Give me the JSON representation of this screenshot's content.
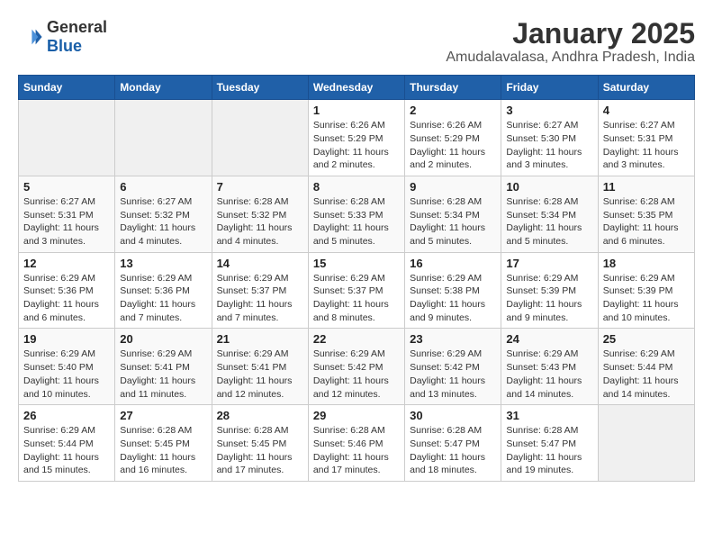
{
  "header": {
    "logo_general": "General",
    "logo_blue": "Blue",
    "month_title": "January 2025",
    "location": "Amudalavalasa, Andhra Pradesh, India"
  },
  "days_of_week": [
    "Sunday",
    "Monday",
    "Tuesday",
    "Wednesday",
    "Thursday",
    "Friday",
    "Saturday"
  ],
  "weeks": [
    [
      {
        "day": "",
        "info": ""
      },
      {
        "day": "",
        "info": ""
      },
      {
        "day": "",
        "info": ""
      },
      {
        "day": "1",
        "info": "Sunrise: 6:26 AM\nSunset: 5:29 PM\nDaylight: 11 hours\nand 2 minutes."
      },
      {
        "day": "2",
        "info": "Sunrise: 6:26 AM\nSunset: 5:29 PM\nDaylight: 11 hours\nand 2 minutes."
      },
      {
        "day": "3",
        "info": "Sunrise: 6:27 AM\nSunset: 5:30 PM\nDaylight: 11 hours\nand 3 minutes."
      },
      {
        "day": "4",
        "info": "Sunrise: 6:27 AM\nSunset: 5:31 PM\nDaylight: 11 hours\nand 3 minutes."
      }
    ],
    [
      {
        "day": "5",
        "info": "Sunrise: 6:27 AM\nSunset: 5:31 PM\nDaylight: 11 hours\nand 3 minutes."
      },
      {
        "day": "6",
        "info": "Sunrise: 6:27 AM\nSunset: 5:32 PM\nDaylight: 11 hours\nand 4 minutes."
      },
      {
        "day": "7",
        "info": "Sunrise: 6:28 AM\nSunset: 5:32 PM\nDaylight: 11 hours\nand 4 minutes."
      },
      {
        "day": "8",
        "info": "Sunrise: 6:28 AM\nSunset: 5:33 PM\nDaylight: 11 hours\nand 5 minutes."
      },
      {
        "day": "9",
        "info": "Sunrise: 6:28 AM\nSunset: 5:34 PM\nDaylight: 11 hours\nand 5 minutes."
      },
      {
        "day": "10",
        "info": "Sunrise: 6:28 AM\nSunset: 5:34 PM\nDaylight: 11 hours\nand 5 minutes."
      },
      {
        "day": "11",
        "info": "Sunrise: 6:28 AM\nSunset: 5:35 PM\nDaylight: 11 hours\nand 6 minutes."
      }
    ],
    [
      {
        "day": "12",
        "info": "Sunrise: 6:29 AM\nSunset: 5:36 PM\nDaylight: 11 hours\nand 6 minutes."
      },
      {
        "day": "13",
        "info": "Sunrise: 6:29 AM\nSunset: 5:36 PM\nDaylight: 11 hours\nand 7 minutes."
      },
      {
        "day": "14",
        "info": "Sunrise: 6:29 AM\nSunset: 5:37 PM\nDaylight: 11 hours\nand 7 minutes."
      },
      {
        "day": "15",
        "info": "Sunrise: 6:29 AM\nSunset: 5:37 PM\nDaylight: 11 hours\nand 8 minutes."
      },
      {
        "day": "16",
        "info": "Sunrise: 6:29 AM\nSunset: 5:38 PM\nDaylight: 11 hours\nand 9 minutes."
      },
      {
        "day": "17",
        "info": "Sunrise: 6:29 AM\nSunset: 5:39 PM\nDaylight: 11 hours\nand 9 minutes."
      },
      {
        "day": "18",
        "info": "Sunrise: 6:29 AM\nSunset: 5:39 PM\nDaylight: 11 hours\nand 10 minutes."
      }
    ],
    [
      {
        "day": "19",
        "info": "Sunrise: 6:29 AM\nSunset: 5:40 PM\nDaylight: 11 hours\nand 10 minutes."
      },
      {
        "day": "20",
        "info": "Sunrise: 6:29 AM\nSunset: 5:41 PM\nDaylight: 11 hours\nand 11 minutes."
      },
      {
        "day": "21",
        "info": "Sunrise: 6:29 AM\nSunset: 5:41 PM\nDaylight: 11 hours\nand 12 minutes."
      },
      {
        "day": "22",
        "info": "Sunrise: 6:29 AM\nSunset: 5:42 PM\nDaylight: 11 hours\nand 12 minutes."
      },
      {
        "day": "23",
        "info": "Sunrise: 6:29 AM\nSunset: 5:42 PM\nDaylight: 11 hours\nand 13 minutes."
      },
      {
        "day": "24",
        "info": "Sunrise: 6:29 AM\nSunset: 5:43 PM\nDaylight: 11 hours\nand 14 minutes."
      },
      {
        "day": "25",
        "info": "Sunrise: 6:29 AM\nSunset: 5:44 PM\nDaylight: 11 hours\nand 14 minutes."
      }
    ],
    [
      {
        "day": "26",
        "info": "Sunrise: 6:29 AM\nSunset: 5:44 PM\nDaylight: 11 hours\nand 15 minutes."
      },
      {
        "day": "27",
        "info": "Sunrise: 6:28 AM\nSunset: 5:45 PM\nDaylight: 11 hours\nand 16 minutes."
      },
      {
        "day": "28",
        "info": "Sunrise: 6:28 AM\nSunset: 5:45 PM\nDaylight: 11 hours\nand 17 minutes."
      },
      {
        "day": "29",
        "info": "Sunrise: 6:28 AM\nSunset: 5:46 PM\nDaylight: 11 hours\nand 17 minutes."
      },
      {
        "day": "30",
        "info": "Sunrise: 6:28 AM\nSunset: 5:47 PM\nDaylight: 11 hours\nand 18 minutes."
      },
      {
        "day": "31",
        "info": "Sunrise: 6:28 AM\nSunset: 5:47 PM\nDaylight: 11 hours\nand 19 minutes."
      },
      {
        "day": "",
        "info": ""
      }
    ]
  ]
}
